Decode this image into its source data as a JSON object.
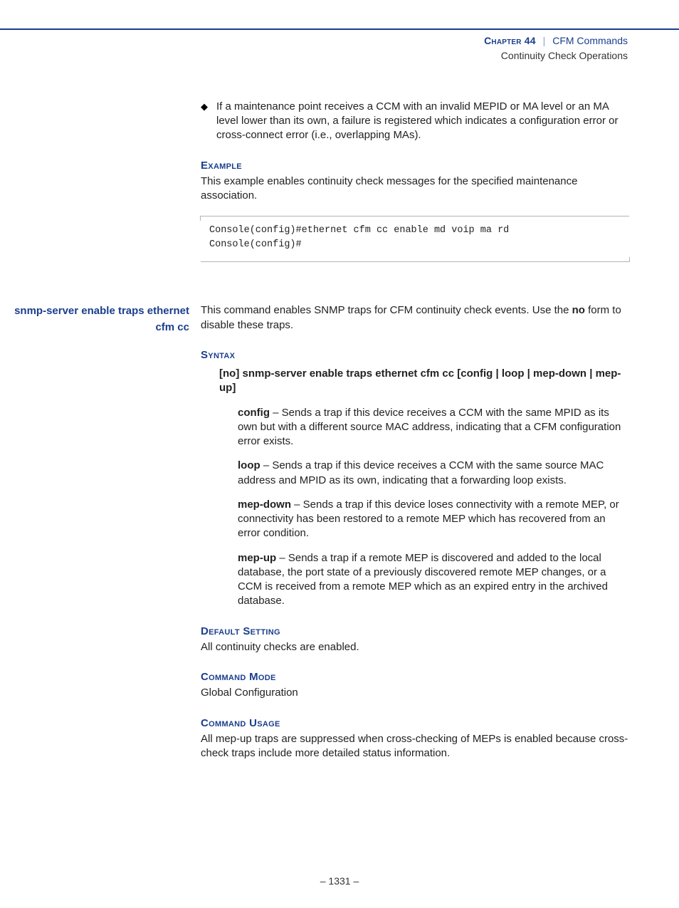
{
  "header": {
    "chapter_label": "Chapter 44",
    "separator": "|",
    "chapter_title": "CFM Commands",
    "section_title": "Continuity Check Operations"
  },
  "block1": {
    "bullet_text": "If a maintenance point receives a CCM with an invalid MEPID or MA level or an MA level lower than its own, a failure is registered which indicates a configuration error or cross-connect error (i.e., overlapping MAs).",
    "example_heading": "Example",
    "example_intro": "This example enables continuity check messages for the specified maintenance association.",
    "code": "Console(config)#ethernet cfm cc enable md voip ma rd\nConsole(config)#"
  },
  "block2": {
    "left_label": "snmp-server enable traps ethernet cfm cc",
    "intro_pre": "This command enables SNMP traps for CFM continuity check events. Use the ",
    "intro_bold": "no",
    "intro_post": " form to disable these traps.",
    "syntax_heading": "Syntax",
    "syntax_line_parts": {
      "lb1": "[",
      "no": "no",
      "rb1": "] ",
      "cmd": "snmp-server enable traps ethernet cfm cc",
      "lb2": " [",
      "config": "config",
      "bar1": " | ",
      "loop": "loop",
      "bar2": " | ",
      "mepdown": "mep-down",
      "bar3": " | ",
      "mepup": "mep-up",
      "rb2": "]"
    },
    "params": [
      {
        "name": "config",
        "desc": " – Sends a trap if this device receives a CCM with the same MPID as its own but with a different source MAC address, indicating that a CFM configuration error exists."
      },
      {
        "name": "loop",
        "desc": " – Sends a trap if this device receives a CCM with the same source MAC address and MPID as its own, indicating that a forwarding loop exists."
      },
      {
        "name": "mep-down",
        "desc": " – Sends a trap if this device loses connectivity with a remote MEP, or connectivity has been restored to a remote MEP which has recovered from an error condition."
      },
      {
        "name": "mep-up",
        "desc": " – Sends a trap if a remote MEP is discovered and added to the local database, the port state of a previously discovered remote MEP changes, or a CCM is received from a remote MEP which as an expired entry in the archived database."
      }
    ],
    "default_heading": "Default Setting",
    "default_text": "All continuity checks are enabled.",
    "mode_heading": "Command Mode",
    "mode_text": "Global Configuration",
    "usage_heading": "Command Usage",
    "usage_text": "All mep-up traps are suppressed when cross-checking of MEPs is enabled because cross-check traps include more detailed status information."
  },
  "footer": {
    "page": "–  1331  –"
  }
}
